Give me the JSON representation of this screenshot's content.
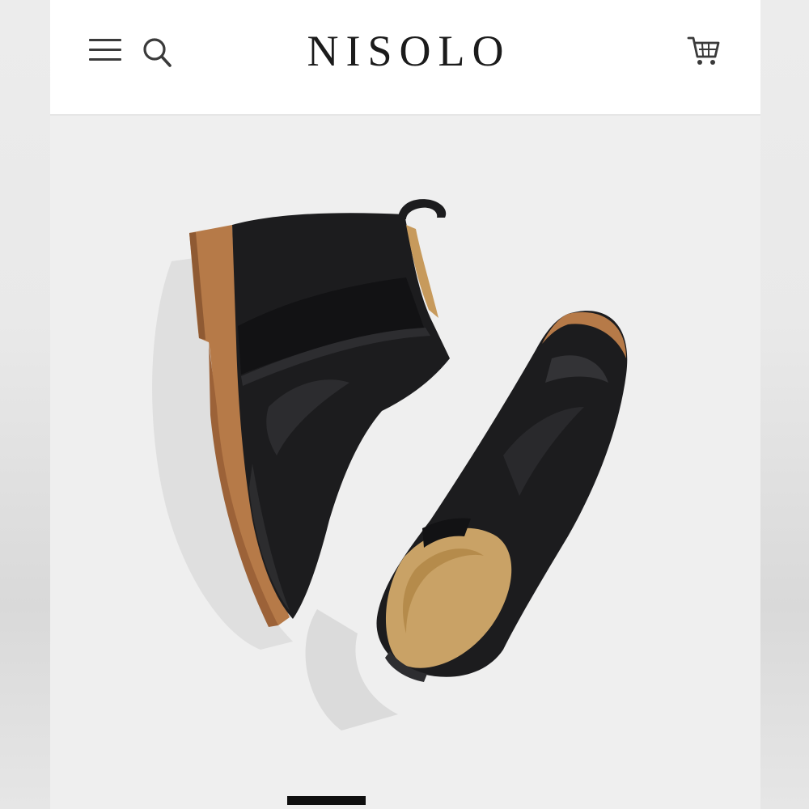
{
  "header": {
    "brand": "NISOLO",
    "menu_icon": "hamburger-menu-icon",
    "search_icon": "search-icon",
    "cart_icon": "shopping-cart-icon"
  },
  "hero": {
    "product_image": "black-leather-chelsea-boots",
    "slide_indicator": {
      "active_index": 0
    }
  },
  "colors": {
    "header_bg": "#ffffff",
    "hero_bg": "#efefef",
    "boot_leather": "#1c1c1e",
    "boot_sole": "#b87a4a",
    "boot_lining": "#c9a266",
    "indicator": "#0f0f0f"
  }
}
